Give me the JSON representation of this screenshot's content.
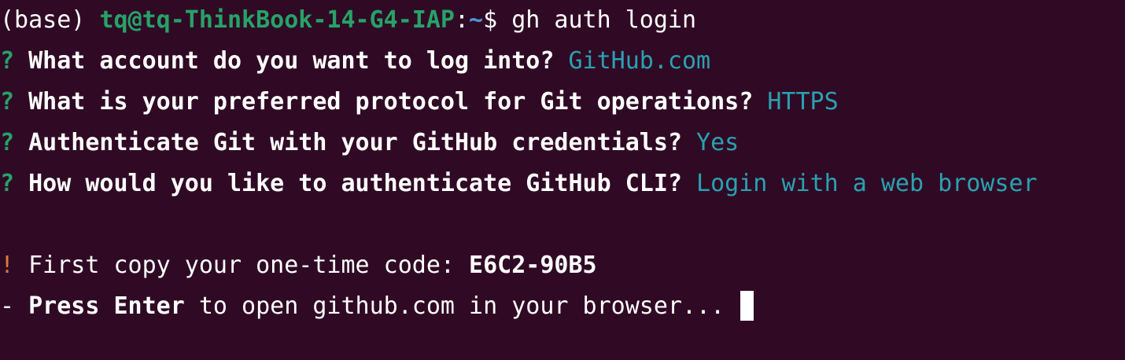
{
  "prompt": {
    "env": "(base) ",
    "user_host": "tq@tq-ThinkBook-14-G4-IAP",
    "separator": ":",
    "path": "~",
    "symbol": "$ ",
    "command": "gh auth login"
  },
  "questions": [
    {
      "marker": "? ",
      "question": "What account do you want to log into?",
      "answer": "GitHub.com"
    },
    {
      "marker": "? ",
      "question": "What is your preferred protocol for Git operations?",
      "answer": "HTTPS"
    },
    {
      "marker": "? ",
      "question": "Authenticate Git with your GitHub credentials?",
      "answer": "Yes"
    },
    {
      "marker": "? ",
      "question": "How would you like to authenticate GitHub CLI?",
      "answer": "Login with a web browser"
    }
  ],
  "code_line": {
    "marker": "! ",
    "text": "First copy your one-time code: ",
    "code": "E6C2-90B5"
  },
  "enter_line": {
    "marker": "- ",
    "bold_text": "Press Enter",
    "text": " to open github.com in your browser... "
  },
  "colors": {
    "background": "#300a24",
    "prompt_green": "#26a269",
    "path_blue": "#4a9ad6",
    "answer_cyan": "#2aa1b3",
    "warning_orange": "#d97a3a"
  }
}
